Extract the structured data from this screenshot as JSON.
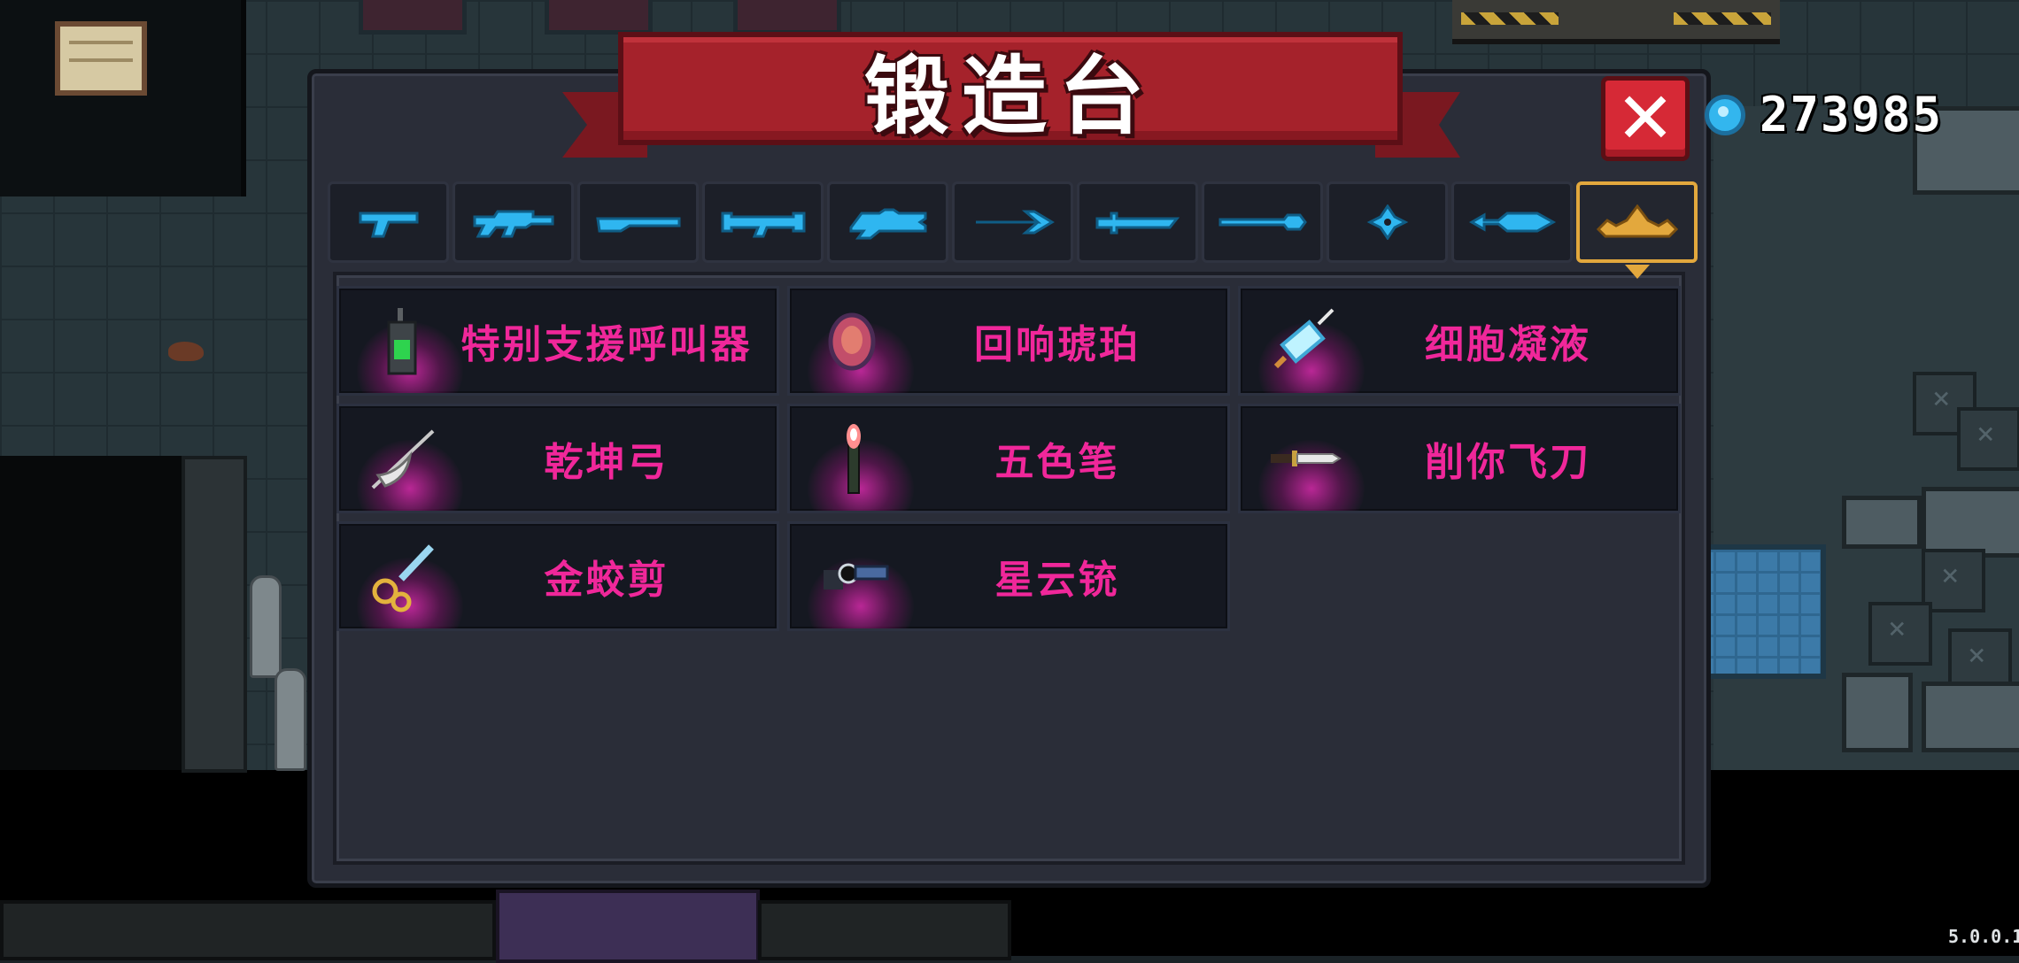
{
  "title": "锻造台",
  "close_label": "✕",
  "currency": {
    "icon": "gem-icon",
    "value": "273985"
  },
  "tabs": [
    {
      "icon": "pistol-icon",
      "active": false
    },
    {
      "icon": "assault-rifle-icon",
      "active": false
    },
    {
      "icon": "shotgun-icon",
      "active": false
    },
    {
      "icon": "rocket-launcher-icon",
      "active": false
    },
    {
      "icon": "laser-gun-icon",
      "active": false
    },
    {
      "icon": "bow-icon",
      "active": false
    },
    {
      "icon": "sword-icon",
      "active": false
    },
    {
      "icon": "spear-icon",
      "active": false
    },
    {
      "icon": "shuriken-icon",
      "active": false
    },
    {
      "icon": "fish-staff-icon",
      "active": false
    },
    {
      "icon": "special-crown-icon",
      "active": true
    }
  ],
  "items": [
    {
      "name": "特别支援呼叫器",
      "icon": "walkie-talkie-icon"
    },
    {
      "name": "回响琥珀",
      "icon": "amber-gem-icon"
    },
    {
      "name": "细胞凝液",
      "icon": "syringe-icon"
    },
    {
      "name": "乾坤弓",
      "icon": "winged-bow-icon"
    },
    {
      "name": "五色笔",
      "icon": "brush-icon"
    },
    {
      "name": "削你飞刀",
      "icon": "throwing-knife-icon"
    },
    {
      "name": "金蛟剪",
      "icon": "golden-scissors-icon"
    },
    {
      "name": "星云铳",
      "icon": "nebula-gun-icon"
    }
  ],
  "version": "5.0.0.1",
  "colors": {
    "banner": "#a5222b",
    "close": "#d62936",
    "item_text": "#f0279a",
    "tab_icon": "#2fb6f0",
    "active_tab_border": "#e3a83d"
  }
}
